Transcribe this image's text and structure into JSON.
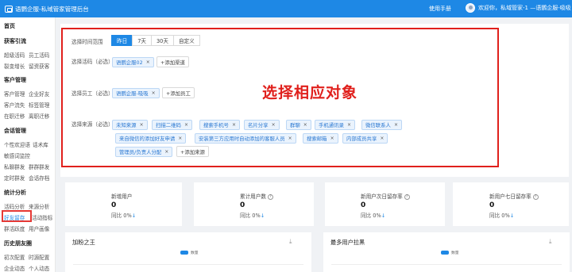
{
  "topbar": {
    "app_title": "语鹦企服-私域管家管理后台",
    "manual_link": "使用手册",
    "user_greeting": "欢迎你，私域管家-1 —语鹦企服-吸吸"
  },
  "sidebar": {
    "home": "首页",
    "sections": [
      {
        "title": "获客引流",
        "items": [
          "超级活码",
          "员工活码",
          "裂变增长",
          "留资获客"
        ]
      },
      {
        "title": "客户管理",
        "items": [
          "客户管理",
          "企业好友",
          "客户流失",
          "标签管理",
          "在职迁移",
          "离职迁移"
        ]
      },
      {
        "title": "会话管理",
        "items": [
          "个性欢迎语",
          "话术库",
          "敏感词监控",
          "私聊群发",
          "群群群发",
          "定时群发",
          "会话存档"
        ]
      },
      {
        "title": "统计分析",
        "items": [
          "活码分析",
          "来源分析",
          "好友留存",
          "活动指标",
          "群活跃度",
          "用户画像"
        ]
      },
      {
        "title": "历史朋友圈",
        "items": [
          "初次配置",
          "时源配置",
          "企业动态",
          "个人动态"
        ]
      }
    ]
  },
  "filters": {
    "time_label": "选择时间范围",
    "time_options": [
      "昨日",
      "7天",
      "30天",
      "自定义"
    ],
    "time_selected": "昨日",
    "code_label": "选择活码（必选）",
    "code_tags": [
      "语鹦企服02"
    ],
    "code_add": "+添加渠道",
    "staff_label": "选择员工（必选）",
    "staff_tags": [
      "语鹦企服-吸吸"
    ],
    "staff_add": "+添加员工",
    "source_label": "选择来源（必选）",
    "source_tags": [
      "未知来源",
      "扫描二维码",
      "搜索手机号",
      "名片分享",
      "群聊",
      "手机通讯录",
      "微信联系人",
      "来自微信的添加好友申请",
      "安装第三方应用时自动添加的客服人员",
      "搜索邮箱",
      "内部成员共享",
      "管理员/负责人分配"
    ],
    "source_add": "+添加来源"
  },
  "overlay_title": "选择相应对象",
  "stats": [
    {
      "title": "新增用户",
      "value": "0",
      "compare": "同比 0%"
    },
    {
      "title": "累计用户数",
      "value": "0",
      "compare": "同比 0%"
    },
    {
      "title": "新用户次日留存率",
      "value": "0",
      "compare": "同比 0%"
    },
    {
      "title": "新用户七日留存率",
      "value": "0",
      "compare": "同比 0%"
    }
  ],
  "charts": [
    {
      "title": "加粉之王",
      "legend": "数量"
    },
    {
      "title": "最多用户拉黑",
      "legend": "数量"
    }
  ],
  "icons": {
    "close": "×",
    "download": "⤓",
    "down_arrow": "↓",
    "help": "?"
  },
  "colors": {
    "primary": "#1e88e5",
    "annotation_red": "#e0201c"
  }
}
